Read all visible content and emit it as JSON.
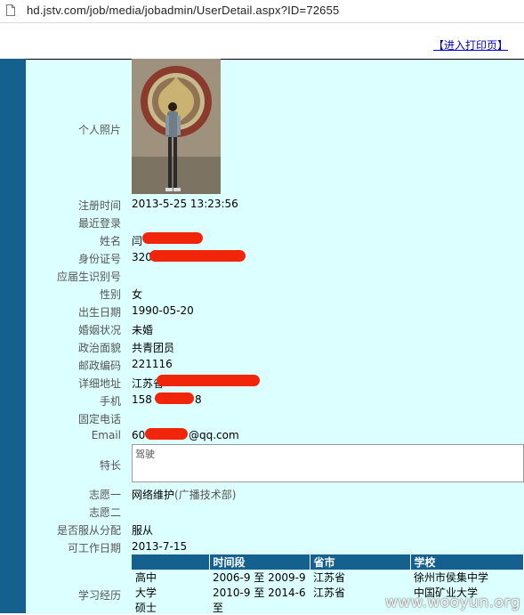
{
  "browser": {
    "url": "hd.jstv.com/job/media/jobadmin/UserDetail.aspx?ID=72655"
  },
  "page": {
    "print_link": "【进入打印页】"
  },
  "fields": {
    "photo_label": "个人照片",
    "reg_time_label": "注册时间",
    "reg_time": "2013-5-25 13:23:56",
    "last_login_label": "最近登录",
    "last_login": "",
    "name_label": "姓名",
    "name": "闫",
    "id_label": "身份证号",
    "id": "320",
    "student_no_label": "应届生识别号",
    "student_no": "",
    "gender_label": "性别",
    "gender": "女",
    "birth_label": "出生日期",
    "birth": "1990-05-20",
    "marital_label": "婚姻状况",
    "marital": "未婚",
    "political_label": "政治面貌",
    "political": "共青团员",
    "postcode_label": "邮政编码",
    "postcode": "221116",
    "address_label": "详细地址",
    "address": "江苏省",
    "mobile_label": "手机",
    "mobile_prefix": "158",
    "mobile_suffix": "8",
    "phone_label": "固定电话",
    "phone": "",
    "email_label": "Email",
    "email_prefix": "60",
    "email_suffix": "@qq.com",
    "specialty_label": "特长",
    "specialty": "驾驶",
    "wish1_label": "志愿一",
    "wish1": "网络维护",
    "wish1_dept": "(广播技术部)",
    "wish2_label": "志愿二",
    "wish2": "",
    "obey_label": "是否服从分配",
    "obey": "服从",
    "available_label": "可工作日期",
    "available": "2013-7-15",
    "edu_label": "学习经历"
  },
  "education": {
    "headers": [
      "",
      "时间段",
      "省市",
      "学校"
    ],
    "rows": [
      [
        "高中",
        "2006-9 至 2009-9",
        "江苏省",
        "徐州市侯集中学"
      ],
      [
        "大学",
        "2010-9 至 2014-6",
        "江苏省",
        "中国矿业大学"
      ],
      [
        "硕士",
        "至",
        "",
        ""
      ]
    ]
  },
  "watermark": "www.wooyun.org",
  "colors": {
    "sidebar": "#14608e",
    "panel": "#dcffff",
    "redaction": "#f0250a",
    "link": "#0000cc"
  }
}
